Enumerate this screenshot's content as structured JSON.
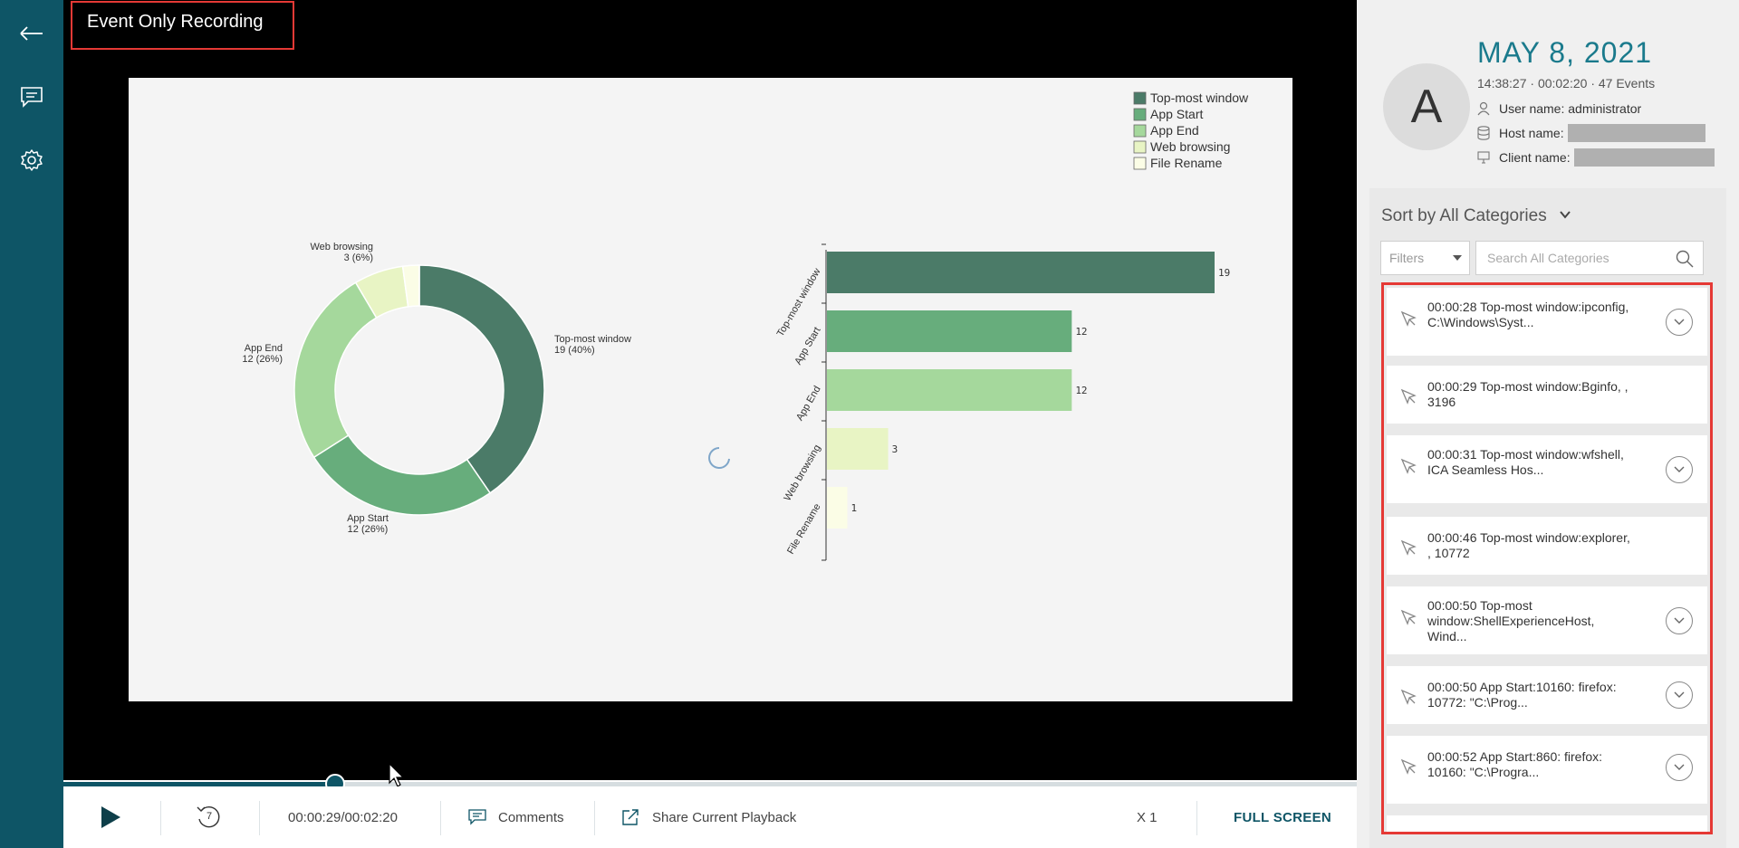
{
  "recording": {
    "title": "Event Only Recording"
  },
  "nav": {
    "items": [
      {
        "icon": "back-arrow-icon"
      },
      {
        "icon": "comment-icon"
      },
      {
        "icon": "gear-icon"
      }
    ]
  },
  "chart_data": [
    {
      "type": "pie",
      "variant": "donut",
      "categories": [
        "Top-most window",
        "App Start",
        "App End",
        "Web browsing",
        "File Rename"
      ],
      "values": [
        19,
        12,
        12,
        3,
        1
      ],
      "labels": [
        {
          "name": "Top-most window",
          "detail": "19 (40%)"
        },
        {
          "name": "App Start",
          "detail": "12 (26%)"
        },
        {
          "name": "App End",
          "detail": "12 (26%)"
        },
        {
          "name": "Web browsing",
          "detail": "3 (6%)"
        }
      ],
      "colors": [
        "#4b7b68",
        "#67ad7c",
        "#a5d89c",
        "#e8f4c4",
        "#fbfde6"
      ]
    },
    {
      "type": "bar",
      "orientation": "horizontal",
      "categories": [
        "Top-most window",
        "App Start",
        "App End",
        "Web browsing",
        "File Rename"
      ],
      "values": [
        19,
        12,
        12,
        3,
        1
      ],
      "xlim": [
        0,
        19
      ],
      "colors": [
        "#4b7b68",
        "#67ad7c",
        "#a5d89c",
        "#e8f4c4",
        "#fbfde6"
      ]
    }
  ],
  "legend": {
    "items": [
      {
        "label": "Top-most window",
        "color": "#4b7b68"
      },
      {
        "label": "App Start",
        "color": "#67ad7c"
      },
      {
        "label": "App End",
        "color": "#a5d89c"
      },
      {
        "label": "Web browsing",
        "color": "#e8f4c4"
      },
      {
        "label": "File Rename",
        "color": "#fbfde6"
      }
    ]
  },
  "playback": {
    "progress": 0.21,
    "rewind_seconds": "7",
    "time": "00:00:29/00:02:20",
    "comments_label": "Comments",
    "share_label": "Share Current Playback",
    "speed": "X 1",
    "fullscreen_label": "FULL SCREEN"
  },
  "session": {
    "avatar_letter": "A",
    "date": "MAY 8, 2021",
    "stats": "14:38:27 · 00:02:20 · 47 Events",
    "user_label": "User name: administrator",
    "host_label": "Host name:",
    "client_label": "Client name:"
  },
  "sidebar": {
    "sort_label": "Sort by All Categories",
    "filters_label": "Filters",
    "search_placeholder": "Search All Categories"
  },
  "events": [
    {
      "text": "00:00:28 Top-most window:ipconfig, C:\\Windows\\Syst...",
      "expandable": true
    },
    {
      "text": "00:00:29 Top-most window:Bginfo, , 3196",
      "expandable": false
    },
    {
      "text": "00:00:31 Top-most window:wfshell, ICA Seamless Hos...",
      "expandable": true
    },
    {
      "text": "00:00:46 Top-most window:explorer, , 10772",
      "expandable": false
    },
    {
      "text": "00:00:50 Top-most window:ShellExperienceHost, Wind...",
      "expandable": true
    },
    {
      "text": "00:00:50 App Start:10160: firefox: 10772: \"C:\\Prog...",
      "expandable": true
    },
    {
      "text": "00:00:52 App Start:860: firefox: 10160: \"C:\\Progra...",
      "expandable": true
    }
  ]
}
